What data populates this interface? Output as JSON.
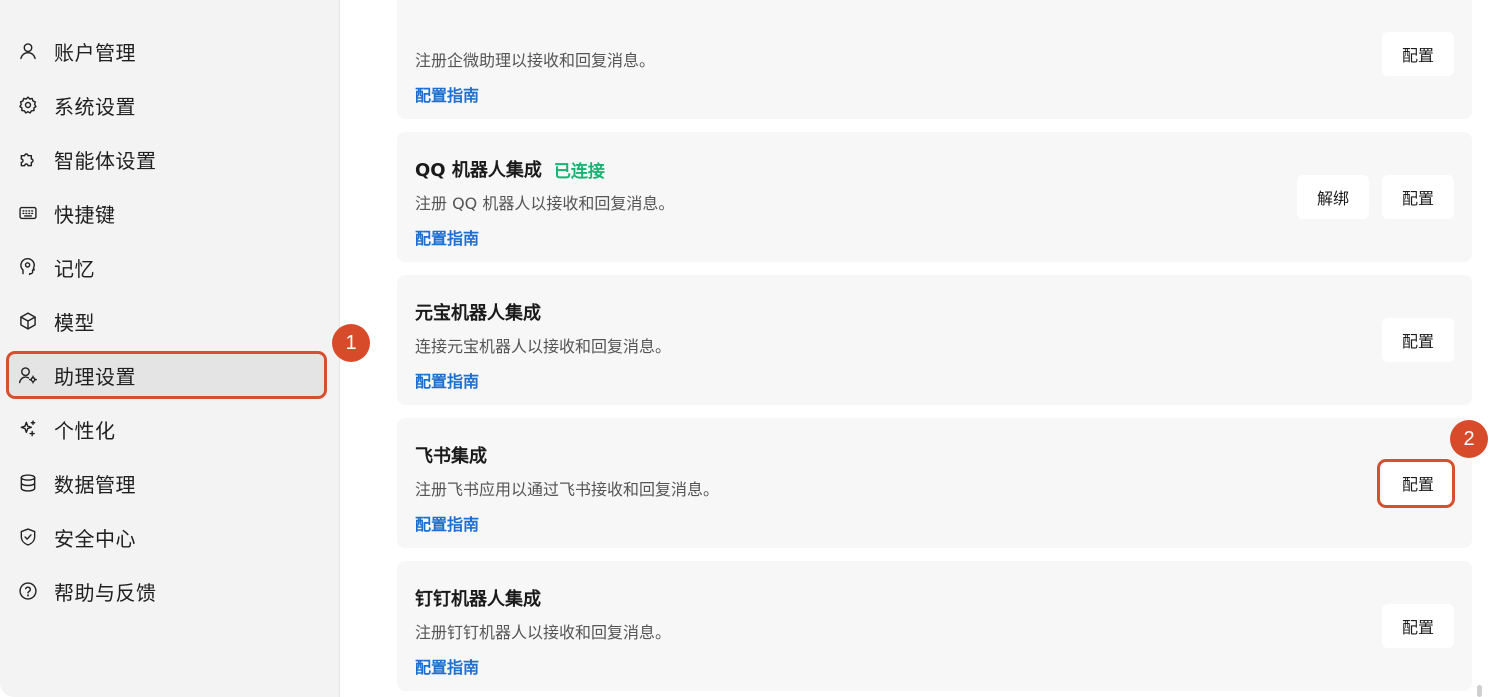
{
  "sidebar": {
    "items": [
      {
        "label": "账户管理",
        "icon": "user-icon"
      },
      {
        "label": "系统设置",
        "icon": "gear-icon"
      },
      {
        "label": "智能体设置",
        "icon": "puzzle-icon"
      },
      {
        "label": "快捷键",
        "icon": "keyboard-icon"
      },
      {
        "label": "记忆",
        "icon": "brain-icon"
      },
      {
        "label": "模型",
        "icon": "cube-icon"
      },
      {
        "label": "助理设置",
        "icon": "user-gear-icon",
        "active": true
      },
      {
        "label": "个性化",
        "icon": "sparkle-icon"
      },
      {
        "label": "数据管理",
        "icon": "database-icon"
      },
      {
        "label": "安全中心",
        "icon": "shield-check-icon"
      },
      {
        "label": "帮助与反馈",
        "icon": "help-circle-icon"
      }
    ]
  },
  "annotations": {
    "badge1": "1",
    "badge2": "2"
  },
  "cards": [
    {
      "title": "",
      "status": "",
      "desc": "注册企微助理以接收和回复消息。",
      "link": "配置指南",
      "config": "配置"
    },
    {
      "title": "QQ 机器人集成",
      "status": "已连接",
      "desc": "注册 QQ 机器人以接收和回复消息。",
      "link": "配置指南",
      "unbind": "解绑",
      "config": "配置"
    },
    {
      "title": "元宝机器人集成",
      "status": "",
      "desc": "连接元宝机器人以接收和回复消息。",
      "link": "配置指南",
      "config": "配置"
    },
    {
      "title": "飞书集成",
      "status": "",
      "desc": "注册飞书应用以通过飞书接收和回复消息。",
      "link": "配置指南",
      "config": "配置"
    },
    {
      "title": "钉钉机器人集成",
      "status": "",
      "desc": "注册钉钉机器人以接收和回复消息。",
      "link": "配置指南",
      "config": "配置"
    }
  ],
  "colors": {
    "accent_link": "#1f6fd0",
    "status_connected": "#18b373",
    "annotation": "#d84b2a"
  }
}
